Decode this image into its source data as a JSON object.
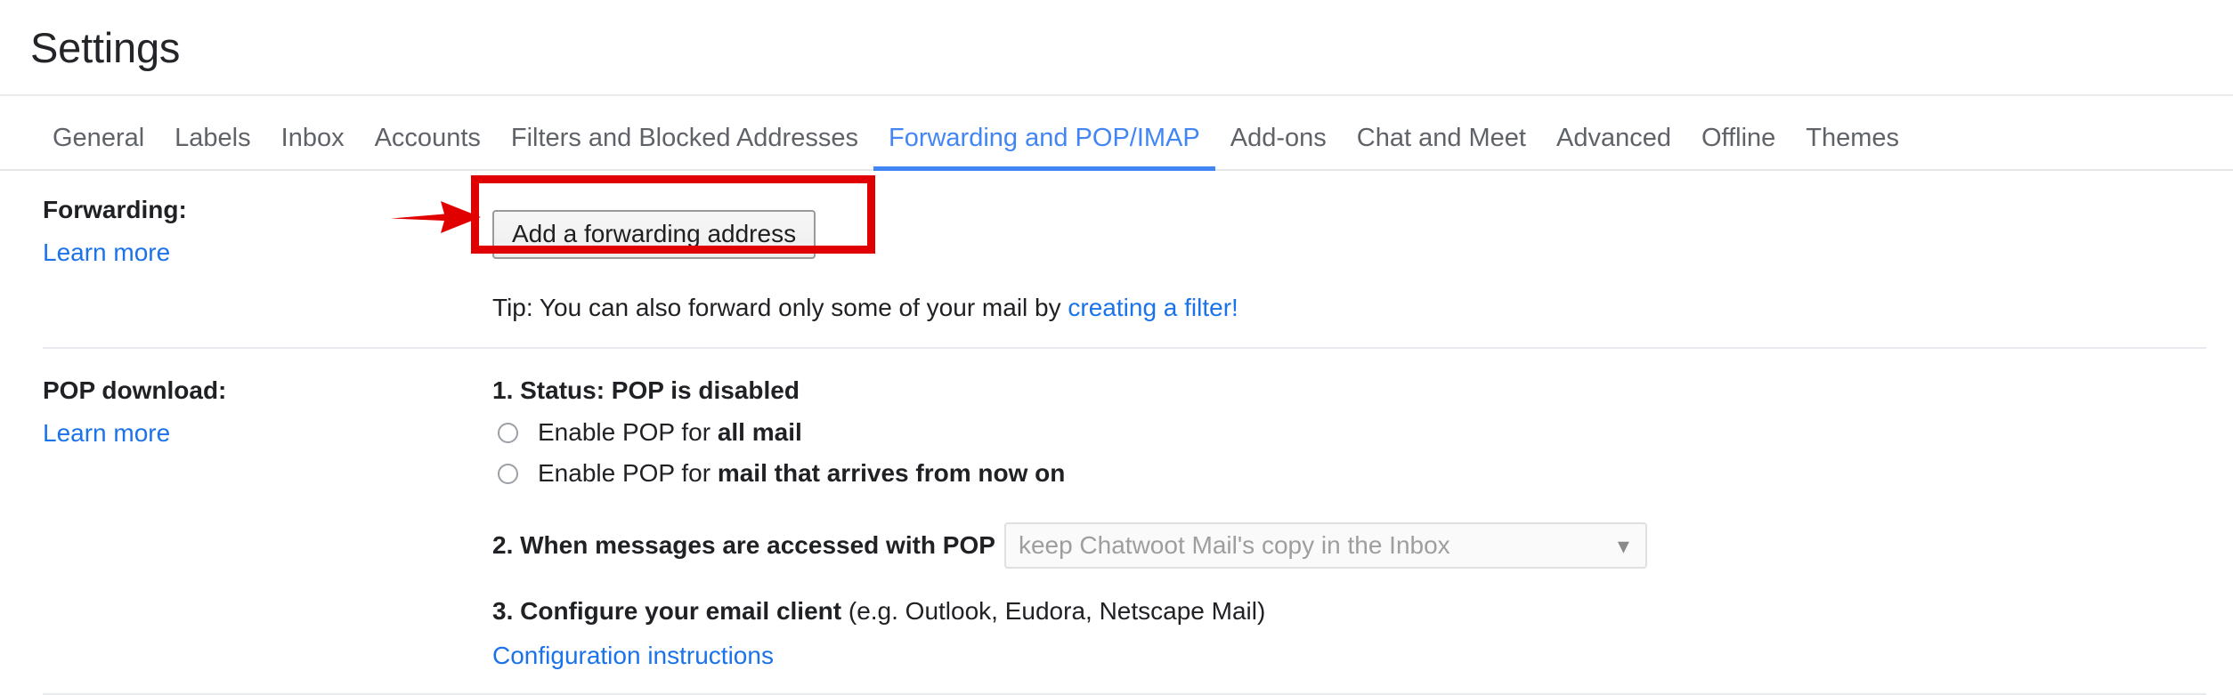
{
  "header": {
    "title": "Settings"
  },
  "tabs": [
    {
      "label": "General",
      "active": false
    },
    {
      "label": "Labels",
      "active": false
    },
    {
      "label": "Inbox",
      "active": false
    },
    {
      "label": "Accounts",
      "active": false
    },
    {
      "label": "Filters and Blocked Addresses",
      "active": false
    },
    {
      "label": "Forwarding and POP/IMAP",
      "active": true
    },
    {
      "label": "Add-ons",
      "active": false
    },
    {
      "label": "Chat and Meet",
      "active": false
    },
    {
      "label": "Advanced",
      "active": false
    },
    {
      "label": "Offline",
      "active": false
    },
    {
      "label": "Themes",
      "active": false
    }
  ],
  "forwarding": {
    "label": "Forwarding:",
    "learn_more": "Learn more",
    "add_button": "Add a forwarding address",
    "tip_prefix": "Tip: You can also forward only some of your mail by ",
    "tip_link": "creating a filter!"
  },
  "pop": {
    "label": "POP download:",
    "learn_more": "Learn more",
    "status": "1. Status: POP is disabled",
    "option_all_prefix": "Enable POP for ",
    "option_all_bold": "all mail",
    "option_all_selected": false,
    "option_now_prefix": "Enable POP for ",
    "option_now_bold": "mail that arrives from now on",
    "option_now_selected": false,
    "step2_label": "2. When messages are accessed with POP",
    "step2_select_value": "keep Chatwoot Mail's copy in the Inbox",
    "step2_select_disabled": true,
    "step3_bold": "3. Configure your email client",
    "step3_rest": " (e.g. Outlook, Eudora, Netscape Mail)",
    "config_link": "Configuration instructions"
  },
  "annotation": {
    "highlight_color": "#e00000",
    "arrow_color": "#e00000",
    "target": "Add a forwarding address"
  },
  "colors": {
    "accent_blue": "#4285f4",
    "link_blue": "#1a73e8",
    "text": "#202124",
    "muted": "#5f6368",
    "divider": "#e8eaed"
  }
}
